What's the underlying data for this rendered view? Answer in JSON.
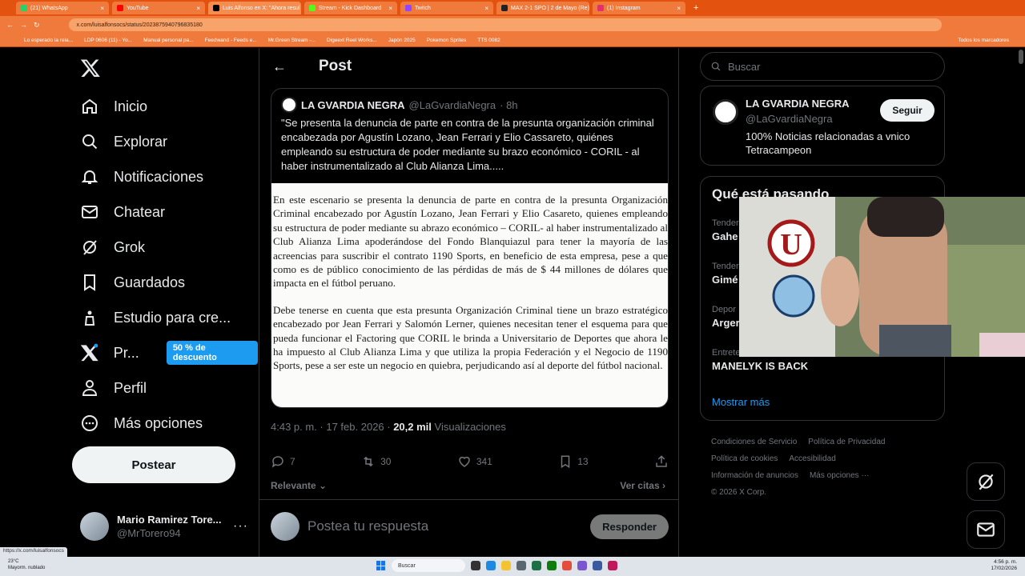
{
  "browser": {
    "tabs": [
      {
        "label": "(21) WhatsApp",
        "color": "#25d366"
      },
      {
        "label": "YouTube",
        "color": "#ff0000"
      },
      {
        "label": "Luis Alfonso en X: \"Ahora resul",
        "color": "#000000"
      },
      {
        "label": "Stream - Kick Dashboard",
        "color": "#53fc18"
      },
      {
        "label": "Twitch",
        "color": "#9146ff"
      },
      {
        "label": "MAX 2-1 SPO | 2 de Mayo (Re)",
        "color": "#222222"
      },
      {
        "label": "(1) Instagram",
        "color": "#e1306c"
      }
    ],
    "url": "x.com/luisalfonsocs/status/2023875940796835180",
    "bookmarks": [
      "Lo esperado la rela...",
      "LDP 0606 (11) - Yo...",
      "Manual personal pa...",
      "Feedwand - Feeds e...",
      "Mr.Green Stream -...",
      "Digeext Reel Works...",
      "Japón 2025",
      "Pokemon Sprites",
      "TTS 0082"
    ],
    "bookmarks_right": "Todos los marcadores",
    "status_url": "https://x.com/luisalfonsocs"
  },
  "sidebar": {
    "items": [
      {
        "label": "Inicio",
        "icon": "home-icon"
      },
      {
        "label": "Explorar",
        "icon": "search-icon"
      },
      {
        "label": "Notificaciones",
        "icon": "bell-icon"
      },
      {
        "label": "Chatear",
        "icon": "mail-icon"
      },
      {
        "label": "Grok",
        "icon": "grok-icon"
      },
      {
        "label": "Guardados",
        "icon": "bookmark-icon"
      },
      {
        "label": "Estudio para cre...",
        "icon": "studio-icon"
      },
      {
        "label": "Pr...",
        "icon": "x-premium-icon"
      },
      {
        "label": "Perfil",
        "icon": "person-icon"
      },
      {
        "label": "Más opciones",
        "icon": "more-circle-icon"
      }
    ],
    "promo_badge": "50 % de descuento",
    "post_button": "Postear",
    "account": {
      "name": "Mario Ramirez Tore...",
      "handle": "@MrTorero94"
    }
  },
  "main": {
    "header_title": "Post",
    "quote": {
      "name": "LA GVARDIA NEGRA",
      "handle": "@LaGvardiaNegra",
      "time": "· 8h",
      "text": "\"Se presenta la denuncia de parte en contra de la presunta organización criminal encabezada por Agustín Lozano, Jean Ferrari y Elio Cassareto, quiénes empleando su estructura de poder mediante su brazo económico - CORIL - al haber instrumentalizado al Club Alianza Lima.....",
      "doc_paragraphs": [
        "En este escenario se presenta la denuncia de parte en contra de la presunta Organización Criminal encabezado por Agustín Lozano, Jean Ferrari y Elio Casareto, quienes empleando su estructura de poder mediante su abrazo económico – CORIL- al haber instrumentalizado al Club Alianza Lima apoderándose del Fondo Blanquiazul para tener la mayoría de las acreencias para suscribir el contrato 1190 Sports, en beneficio de esta empresa, pese a que como es de público conocimiento de las pérdidas de más de $ 44 millones de dólares que impacta en el fútbol peruano.",
        "Debe tenerse en cuenta que esta presunta Organización Criminal tiene un brazo estratégico encabezado por Jean Ferrari y Salomón Lerner, quienes necesitan tener el esquema para que pueda funcionar el Factoring que CORIL le brinda a Universitario de Deportes que ahora le ha impuesto al Club Alianza Lima y que utiliza la propia Federación y el Negocio de 1190 Sports, pese a ser este un negocio en quiebra, perjudicando así al deporte del fútbol nacional."
      ]
    },
    "timestamp": "4:43 p. m. · 17 feb. 2026 · ",
    "views_count": "20,2 mil",
    "views_label": " Visualizaciones",
    "actions": {
      "replies": "7",
      "reposts": "30",
      "likes": "341",
      "bookmarks": "13"
    },
    "relevante": "Relevante",
    "ver_citas": "Ver citas",
    "reply_placeholder": "Postea tu respuesta",
    "reply_button": "Responder"
  },
  "right": {
    "search_placeholder": "Buscar",
    "follow": {
      "name": "LA GVARDIA NEGRA",
      "handle": "@LaGvardiaNegra",
      "bio": "100% Noticias relacionadas a vnico Tetracampeon",
      "button": "Seguir"
    },
    "trends_title": "Qué está pasando",
    "trends": [
      {
        "category": "Tender",
        "name": "Gahe"
      },
      {
        "category": "Tender",
        "name": "Gimé"
      },
      {
        "category": "Depor",
        "name": "Arger"
      },
      {
        "category": "Entrete",
        "name": "MANELYK IS BACK"
      }
    ],
    "show_more": "Mostrar más",
    "footer": [
      "Condiciones de Servicio",
      "Política de Privacidad",
      "Política de cookies",
      "Accesibilidad",
      "Información de anuncios",
      "Más opciones ···",
      "© 2026 X Corp."
    ]
  },
  "taskbar": {
    "weather_temp": "23°C",
    "weather_desc": "Mayorm. nublado",
    "search": "Buscar",
    "time": "4:56 p. m.",
    "date": "17/02/2026"
  }
}
